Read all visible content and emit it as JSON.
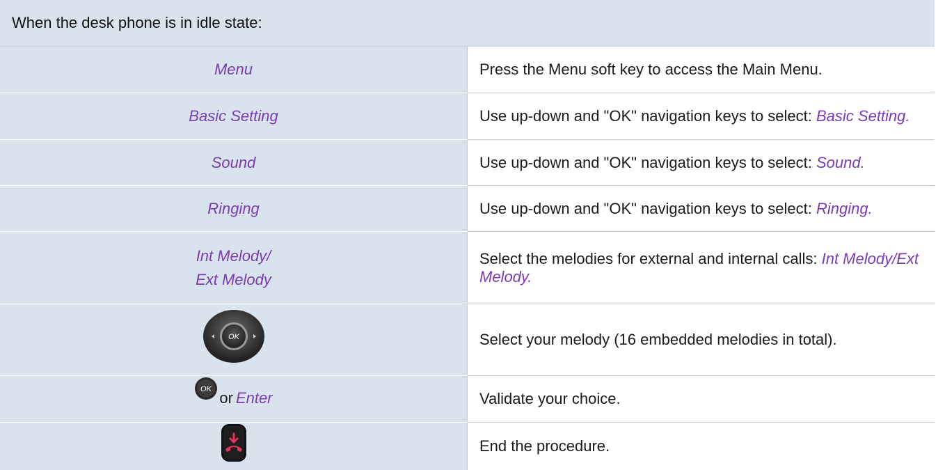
{
  "header": "When the desk phone is in idle state:",
  "rows": [
    {
      "key": "Menu",
      "desc": "Press the Menu soft key to access the Main Menu.",
      "desc_em": ""
    },
    {
      "key": "Basic Setting",
      "desc": "Use up-down and \"OK\" navigation keys to select: ",
      "desc_em": "Basic Setting."
    },
    {
      "key": "Sound",
      "desc": "Use up-down and \"OK\" navigation keys to select: ",
      "desc_em": "Sound."
    },
    {
      "key": "Ringing",
      "desc": "Use up-down and \"OK\" navigation keys to select: ",
      "desc_em": "Ringing."
    },
    {
      "key_line1": "Int Melody/",
      "key_line2": "Ext Melody",
      "desc": "Select the melodies for external and internal calls: ",
      "desc_em": "Int Melody/Ext Melody."
    },
    {
      "key_icon": "navigation-pad-icon",
      "icon_label": "OK",
      "desc": "Select your melody (16 embedded melodies in total)."
    },
    {
      "key_icon": "ok-button-icon",
      "icon_label": "OK",
      "or_text": "or",
      "key": "Enter",
      "desc": "Validate your choice."
    },
    {
      "key_icon": "hang-up-key-icon",
      "desc": "End the procedure."
    }
  ],
  "colors": {
    "key_column_bg": "#d9e3ed",
    "key_text": "#7a3ab4",
    "hangup_red": "#e8325a"
  }
}
